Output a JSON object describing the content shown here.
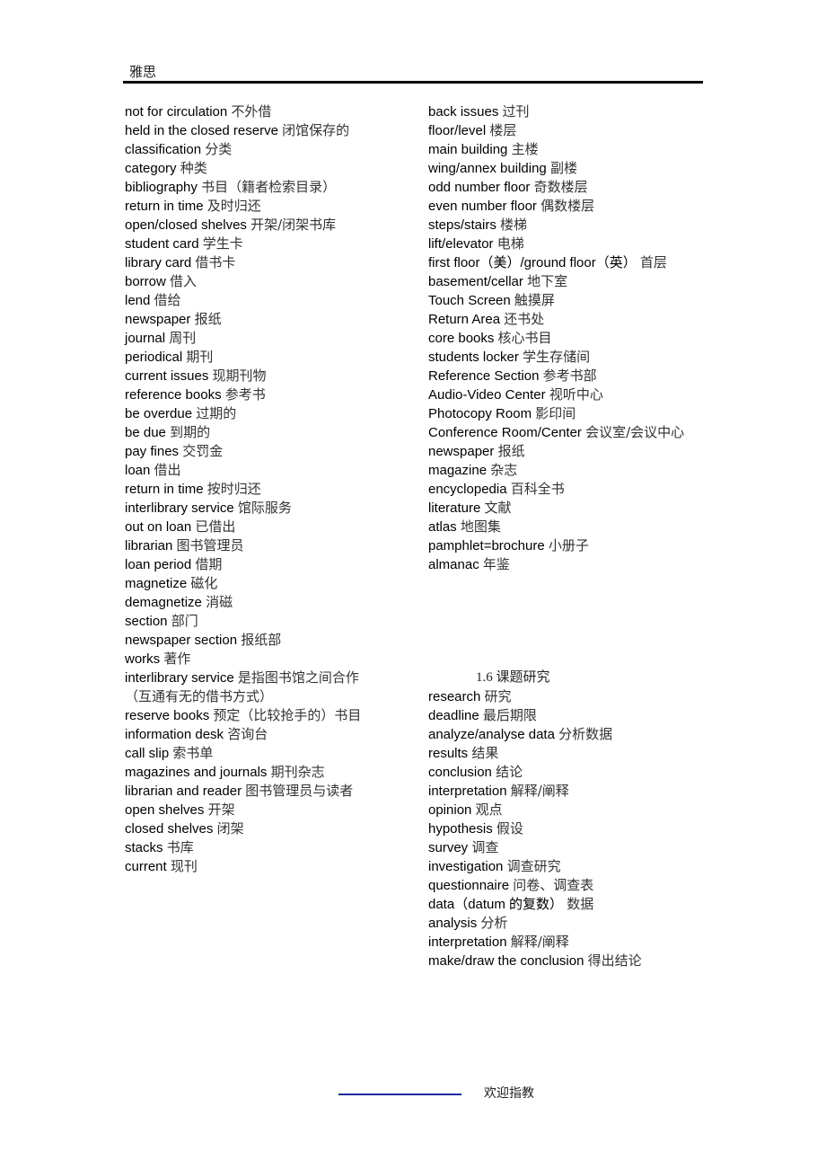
{
  "header": {
    "title": "雅思"
  },
  "left_column": [
    {
      "en": "not for circulation",
      "zh": "不外借"
    },
    {
      "en": "held in the closed reserve",
      "zh": "闭馆保存的"
    },
    {
      "en": "classification",
      "zh": "分类"
    },
    {
      "en": "category",
      "zh": "种类"
    },
    {
      "en": "bibliography",
      "zh": "书目（籍者检索目录）"
    },
    {
      "en": "return in time",
      "zh": "及时归还"
    },
    {
      "en": "open/closed shelves",
      "zh": "开架/闭架书库"
    },
    {
      "en": "student card",
      "zh": "学生卡"
    },
    {
      "en": "library card",
      "zh": "借书卡"
    },
    {
      "en": "borrow",
      "zh": "借入"
    },
    {
      "en": "lend",
      "zh": "借给"
    },
    {
      "en": "newspaper",
      "zh": "报纸"
    },
    {
      "en": "journal",
      "zh": "周刊"
    },
    {
      "en": "periodical",
      "zh": "期刊"
    },
    {
      "en": "current issues",
      "zh": "现期刊物"
    },
    {
      "en": "reference books",
      "zh": "参考书"
    },
    {
      "en": "be overdue",
      "zh": "过期的"
    },
    {
      "en": "be due",
      "zh": "到期的"
    },
    {
      "en": "pay fines",
      "zh": "交罚金"
    },
    {
      "en": "loan",
      "zh": "借出"
    },
    {
      "en": "return in time",
      "zh": "按时归还"
    },
    {
      "en": "interlibrary service",
      "zh": "馆际服务"
    },
    {
      "en": "out on loan",
      "zh": "已借出"
    },
    {
      "en": "librarian",
      "zh": "图书管理员"
    },
    {
      "en": "loan period",
      "zh": "借期"
    },
    {
      "en": "magnetize",
      "zh": "磁化"
    },
    {
      "en": "demagnetize",
      "zh": "消磁"
    },
    {
      "en": "section",
      "zh": "部门"
    },
    {
      "en": "newspaper section",
      "zh": "报纸部"
    },
    {
      "en": "works",
      "zh": "著作"
    },
    {
      "en": "interlibrary service",
      "zh": "是指图书馆之间合作（互通有无的借书方式）"
    },
    {
      "en": "reserve books",
      "zh": "预定（比较抢手的）书目"
    },
    {
      "en": "information desk",
      "zh": "咨询台"
    },
    {
      "en": "call slip",
      "zh": "索书单"
    },
    {
      "en": "magazines and journals",
      "zh": "期刊杂志"
    },
    {
      "en": "librarian and reader",
      "zh": "图书管理员与读者"
    },
    {
      "en": "open shelves",
      "zh": "开架"
    },
    {
      "en": "closed shelves",
      "zh": "闭架"
    },
    {
      "en": "stacks",
      "zh": "书库"
    },
    {
      "en": "current",
      "zh": "现刊"
    }
  ],
  "right_column": [
    {
      "en": "back issues",
      "zh": "过刊"
    },
    {
      "en": "floor/level",
      "zh": "楼层"
    },
    {
      "en": "main building",
      "zh": "主楼"
    },
    {
      "en": "wing/annex building",
      "zh": "副楼"
    },
    {
      "en": "odd number floor",
      "zh": "奇数楼层"
    },
    {
      "en": "even number floor",
      "zh": "偶数楼层"
    },
    {
      "en": "steps/stairs",
      "zh": "楼梯"
    },
    {
      "en": "lift/elevator",
      "zh": "电梯"
    },
    {
      "en": "first floor（美）/ground floor（英）",
      "zh": "首层"
    },
    {
      "en": "basement/cellar",
      "zh": "地下室"
    },
    {
      "en": "Touch Screen",
      "zh": "触摸屏"
    },
    {
      "en": "Return Area",
      "zh": "还书处"
    },
    {
      "en": "core books",
      "zh": "核心书目"
    },
    {
      "en": "students locker",
      "zh": "学生存储间"
    },
    {
      "en": "Reference Section",
      "zh": "参考书部"
    },
    {
      "en": "Audio-Video Center",
      "zh": "视听中心"
    },
    {
      "en": "Photocopy Room",
      "zh": "影印间"
    },
    {
      "en": "Conference Room/Center",
      "zh": "会议室/会议中心"
    },
    {
      "en": "newspaper",
      "zh": "报纸"
    },
    {
      "en": "magazine",
      "zh": "杂志"
    },
    {
      "en": "encyclopedia",
      "zh": "百科全书"
    },
    {
      "en": "literature",
      "zh": "文献"
    },
    {
      "en": "atlas",
      "zh": "地图集"
    },
    {
      "en": "pamphlet=brochure",
      "zh": "小册子"
    },
    {
      "en": "almanac",
      "zh": "年鉴"
    }
  ],
  "research_section": {
    "heading": "1.6 课题研究",
    "entries": [
      {
        "en": "research",
        "zh": "研究"
      },
      {
        "en": "deadline",
        "zh": "最后期限"
      },
      {
        "en": "analyze/analyse data",
        "zh": "分析数据"
      },
      {
        "en": "results",
        "zh": "结果"
      },
      {
        "en": "conclusion",
        "zh": "结论"
      },
      {
        "en": "interpretation",
        "zh": "解释/阐释"
      },
      {
        "en": "opinion",
        "zh": "观点"
      },
      {
        "en": "hypothesis",
        "zh": "假设"
      },
      {
        "en": "survey",
        "zh": "调查"
      },
      {
        "en": "investigation",
        "zh": "调查研究"
      },
      {
        "en": "questionnaire",
        "zh": "问卷、调查表"
      },
      {
        "en": "data（datum 的复数）",
        "zh": "数据"
      },
      {
        "en": "analysis",
        "zh": "分析"
      },
      {
        "en": "interpretation",
        "zh": "解释/阐释"
      },
      {
        "en": "make/draw the conclusion",
        "zh": "得出结论"
      }
    ]
  },
  "footer": {
    "text": "欢迎指教"
  }
}
